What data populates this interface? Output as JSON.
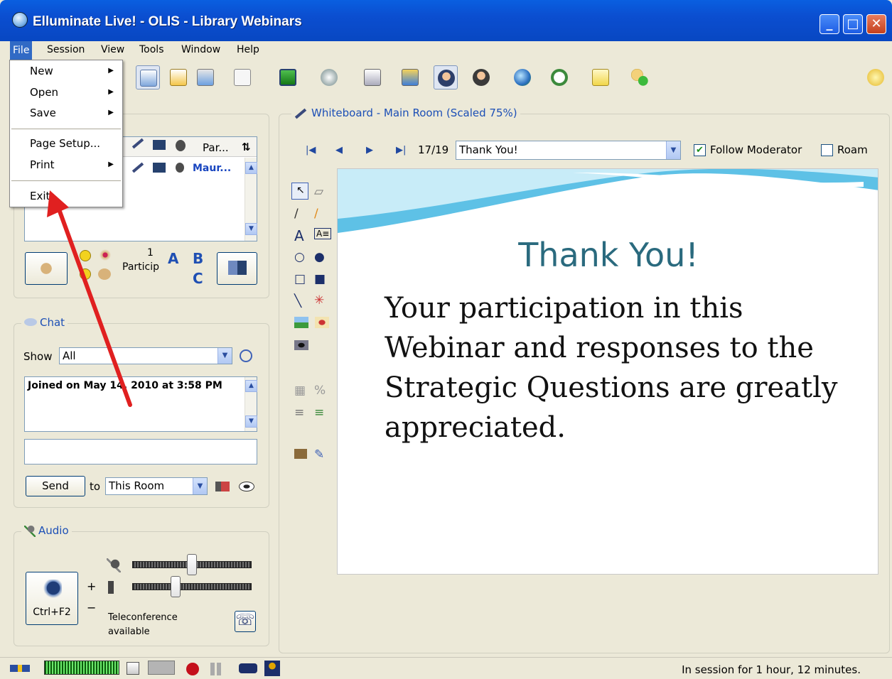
{
  "window": {
    "title": "Elluminate Live! - OLIS - Library Webinars"
  },
  "menubar": {
    "items": [
      "File",
      "Session",
      "View",
      "Tools",
      "Window",
      "Help"
    ]
  },
  "file_menu": {
    "items": [
      {
        "label": "New",
        "submenu": true
      },
      {
        "label": "Open",
        "submenu": true
      },
      {
        "label": "Save",
        "submenu": true
      },
      {
        "label": "Page Setup...",
        "submenu": false
      },
      {
        "label": "Print",
        "submenu": true
      },
      {
        "label": "Exit",
        "submenu": false
      }
    ]
  },
  "participants": {
    "col_header": "Par...",
    "sort_icon": "⇅",
    "row_name": "Maur...",
    "count": "1",
    "count_label": "Particip",
    "letters": [
      "A",
      "B",
      "C"
    ]
  },
  "chat": {
    "label": "Chat",
    "show_label": "Show",
    "show_value": "All",
    "log": "Joined on May 14, 2010 at 3:58 PM",
    "input_value": "",
    "send_label": "Send",
    "to_label": "to",
    "room_value": "This Room"
  },
  "audio": {
    "label": "Audio",
    "talk_button": "Ctrl+F2",
    "plus": "+",
    "minus": "−",
    "teleconference": "Teleconference available",
    "mic_level": 0.5,
    "speaker_level": 0.35
  },
  "whiteboard": {
    "label": "Whiteboard - Main Room (Scaled 75%)",
    "page": "17/19",
    "page_title": "Thank You!",
    "follow_moderator": "Follow Moderator",
    "follow_checked": true,
    "roam": "Roam",
    "roam_checked": false
  },
  "slide": {
    "title": "Thank You!",
    "body": "Your participation in this Webinar  and responses to the Strategic Questions are greatly appreciated."
  },
  "status": {
    "text": "In session for 1 hour, 12 minutes."
  },
  "colors": {
    "titlebar": "#0b4ed0",
    "menu_active": "#316ac5",
    "accent_blue": "#1c4fb6",
    "slide_title": "#2a6a7e",
    "annotation_arrow": "#e02020"
  }
}
